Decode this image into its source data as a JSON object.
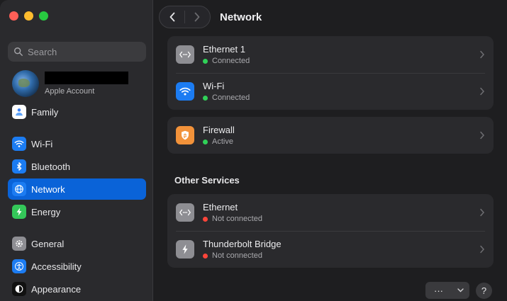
{
  "window": {
    "title": "Network"
  },
  "search": {
    "placeholder": "Search"
  },
  "account": {
    "subtitle": "Apple Account"
  },
  "sidebar": {
    "items": [
      {
        "label": "Family",
        "icon": "family-icon"
      },
      {
        "label": "Wi-Fi",
        "icon": "wifi-icon"
      },
      {
        "label": "Bluetooth",
        "icon": "bluetooth-icon"
      },
      {
        "label": "Network",
        "icon": "globe-icon",
        "active": true
      },
      {
        "label": "Energy",
        "icon": "bolt-icon"
      },
      {
        "label": "General",
        "icon": "gear-icon"
      },
      {
        "label": "Accessibility",
        "icon": "accessibility-icon"
      },
      {
        "label": "Appearance",
        "icon": "appearance-icon"
      }
    ]
  },
  "connections": [
    {
      "name": "Ethernet 1",
      "status": "Connected",
      "status_color": "#30d158",
      "icon": "ethernet-icon"
    },
    {
      "name": "Wi-Fi",
      "status": "Connected",
      "status_color": "#30d158",
      "icon": "wifi-icon"
    }
  ],
  "firewall": {
    "name": "Firewall",
    "status": "Active",
    "status_color": "#30d158",
    "icon": "firewall-icon"
  },
  "other_services": {
    "title": "Other Services",
    "items": [
      {
        "name": "Ethernet",
        "status": "Not connected",
        "status_color": "#ff453a",
        "icon": "ethernet-icon"
      },
      {
        "name": "Thunderbolt Bridge",
        "status": "Not connected",
        "status_color": "#ff453a",
        "icon": "thunderbolt-icon"
      }
    ]
  },
  "footer": {
    "more_label": "···",
    "help_label": "?"
  },
  "colors": {
    "accent": "#0a63d8",
    "connected": "#30d158",
    "disconnected": "#ff453a"
  }
}
